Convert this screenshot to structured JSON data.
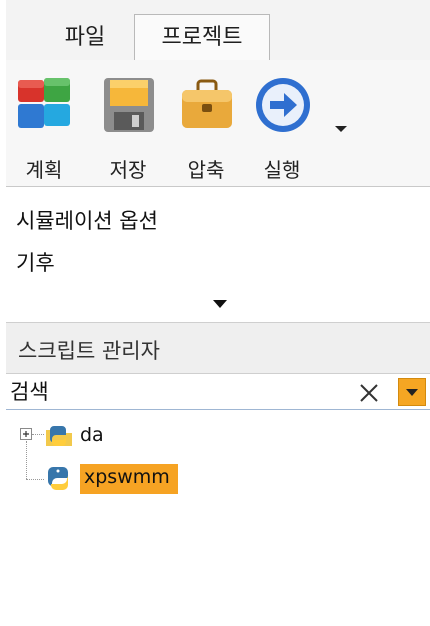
{
  "tabs": [
    {
      "label": "파일",
      "active": false
    },
    {
      "label": "프로젝트",
      "active": true
    }
  ],
  "ribbon": {
    "buttons": [
      {
        "label": "계획",
        "icon": "plan-icon"
      },
      {
        "label": "저장",
        "icon": "save-icon"
      },
      {
        "label": "압축",
        "icon": "compress-icon"
      },
      {
        "label": "실행",
        "icon": "run-icon"
      }
    ],
    "overflow_icon": "chevron-down-icon"
  },
  "options": {
    "items": [
      {
        "label": "시뮬레이션 옵션"
      },
      {
        "label": "기후"
      }
    ],
    "collapse_icon": "triangle-down-icon"
  },
  "script_manager": {
    "title": "스크립트 관리자",
    "search_placeholder": "검색",
    "clear_icon": "close-icon",
    "dropdown_icon": "triangle-down-icon",
    "tree": [
      {
        "label": "da",
        "icon": "python-folder-icon",
        "expandable": true,
        "selected": false
      },
      {
        "label": "xpswmm",
        "icon": "python-icon",
        "expandable": false,
        "selected": true
      }
    ]
  },
  "colors": {
    "selection": "#f6a323",
    "accent_dropdown": "#f5a623"
  }
}
